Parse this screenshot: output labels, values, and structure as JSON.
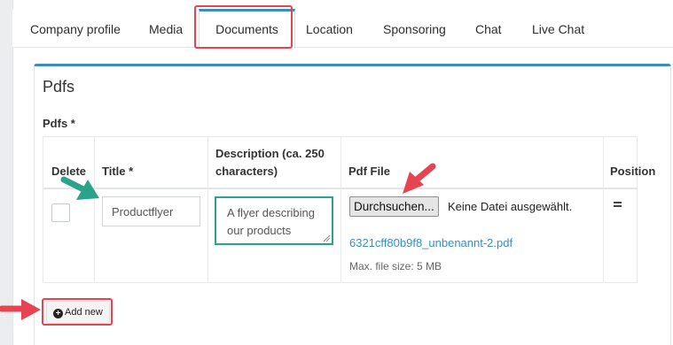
{
  "tabs": [
    {
      "label": "Company profile",
      "active": false
    },
    {
      "label": "Media",
      "active": false
    },
    {
      "label": "Documents",
      "active": true
    },
    {
      "label": "Location",
      "active": false
    },
    {
      "label": "Sponsoring",
      "active": false
    },
    {
      "label": "Chat",
      "active": false
    },
    {
      "label": "Live Chat",
      "active": false
    }
  ],
  "section": {
    "title": "Pdfs",
    "field_label": "Pdfs *"
  },
  "table": {
    "headers": {
      "delete": "Delete",
      "title": "Title *",
      "description_line1": "Description (ca. 250",
      "description_line2": "characters)",
      "file": "Pdf File",
      "position": "Position"
    },
    "rows": [
      {
        "checked": false,
        "title": "Productflyer",
        "description": "A flyer describing our products",
        "browse_label": "Durchsuchen...",
        "file_status": "Keine Datei ausgewählt.",
        "file_name": "6321cff80b9f8_unbenannt-2.pdf",
        "max_size": "Max. file size: 5 MB"
      }
    ]
  },
  "add_button": {
    "icon": "plus-circle-icon",
    "label": "Add new"
  },
  "colors": {
    "accent": "#3c8dbc",
    "annotation_red": "#e84350",
    "annotation_green": "#2aa38a",
    "link": "#3c8dbc"
  }
}
